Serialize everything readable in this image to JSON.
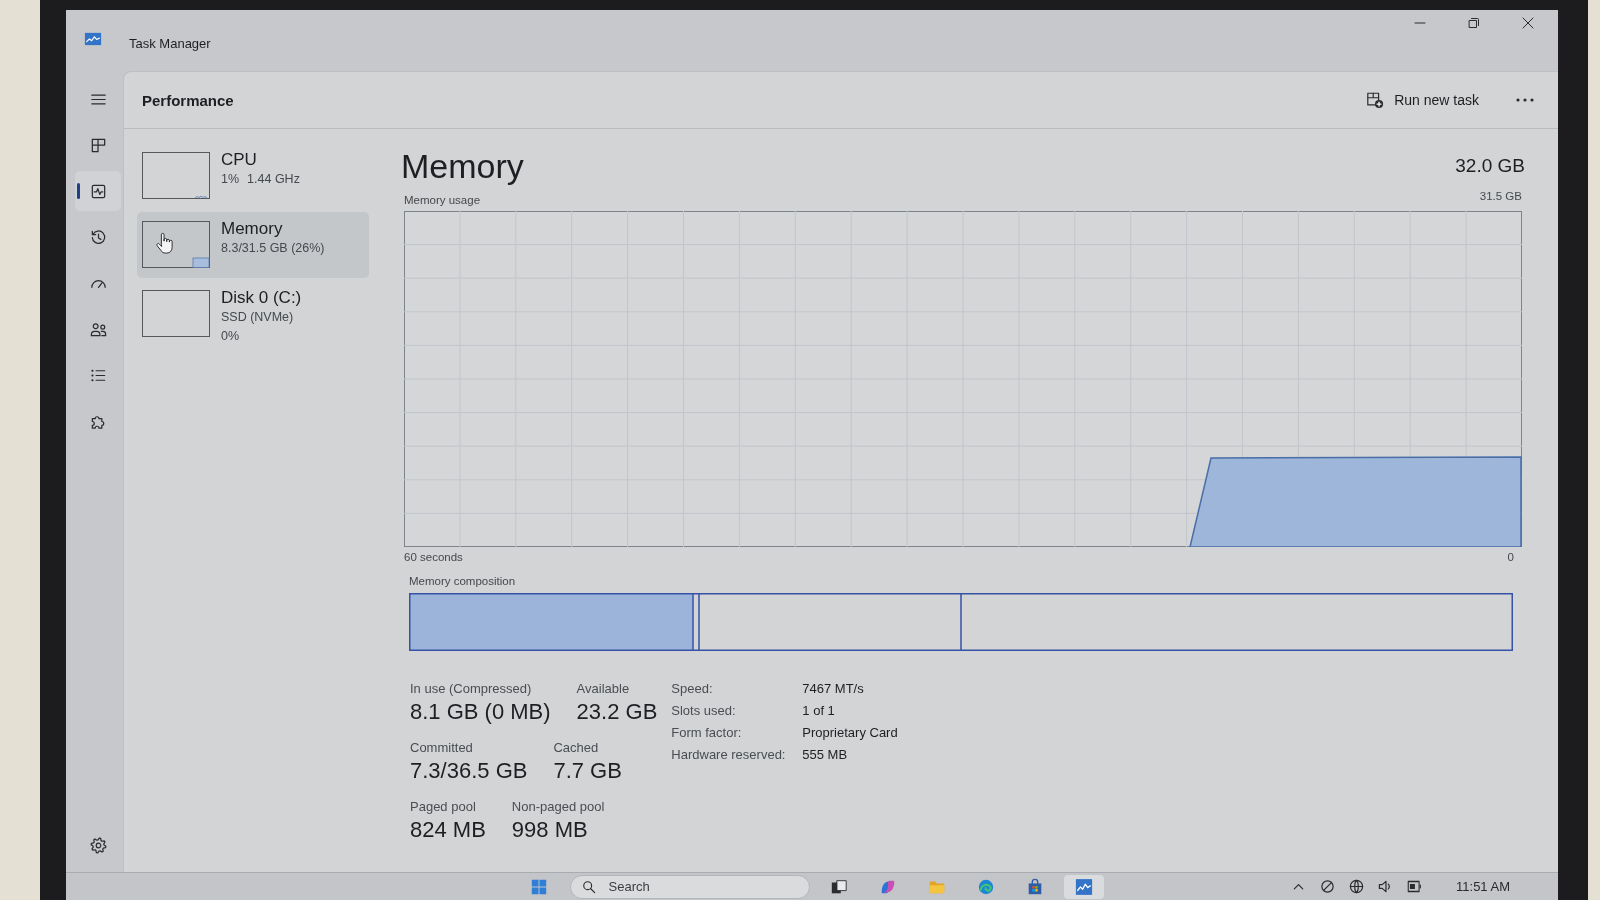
{
  "window": {
    "title": "Task Manager"
  },
  "nav": {
    "items": [
      {
        "selected": false
      },
      {
        "selected": true
      },
      {
        "selected": false
      },
      {
        "selected": false
      },
      {
        "selected": false
      },
      {
        "selected": false
      },
      {
        "selected": false
      }
    ]
  },
  "header": {
    "title": "Performance",
    "action": "Run new task"
  },
  "devices": [
    {
      "kind": "cpu",
      "name": "CPU",
      "lines": [
        [
          "1%",
          "1.44 GHz"
        ]
      ],
      "selected": false
    },
    {
      "kind": "memory",
      "name": "Memory",
      "lines": [
        [
          "8.3/31.5 GB (26%)"
        ]
      ],
      "selected": true
    },
    {
      "kind": "disk",
      "name": "Disk 0 (C:)",
      "lines": [
        [
          "SSD (NVMe)"
        ],
        [
          "0%"
        ]
      ],
      "selected": false
    }
  ],
  "detail": {
    "title": "Memory",
    "total": "32.0 GB",
    "usage_graph": {
      "title": "Memory usage",
      "max_label": "31.5 GB",
      "start_label": "60 seconds",
      "end_label": "0"
    },
    "composition": {
      "label": "Memory composition"
    },
    "stats": [
      [
        {
          "label": "In use (Compressed)",
          "value": "8.1 GB (0 MB)"
        },
        {
          "label": "Available",
          "value": "23.2 GB"
        }
      ],
      [
        {
          "label": "Committed",
          "value": "7.3/36.5 GB"
        },
        {
          "label": "Cached",
          "value": "7.7 GB"
        }
      ],
      [
        {
          "label": "Paged pool",
          "value": "824 MB"
        },
        {
          "label": "Non-paged pool",
          "value": "998 MB"
        }
      ]
    ],
    "properties": [
      {
        "label": "Speed:",
        "value": "7467 MT/s"
      },
      {
        "label": "Slots used:",
        "value": "1 of 1"
      },
      {
        "label": "Form factor:",
        "value": "Proprietary Card"
      },
      {
        "label": "Hardware reserved:",
        "value": "555 MB"
      }
    ]
  },
  "taskbar": {
    "search": {
      "placeholder": "Search"
    },
    "apps": [
      {
        "selected": false
      },
      {
        "selected": false
      },
      {
        "selected": false
      },
      {
        "selected": false
      },
      {
        "selected": false
      },
      {
        "selected": true
      }
    ],
    "clock": "11:51 AM"
  }
}
